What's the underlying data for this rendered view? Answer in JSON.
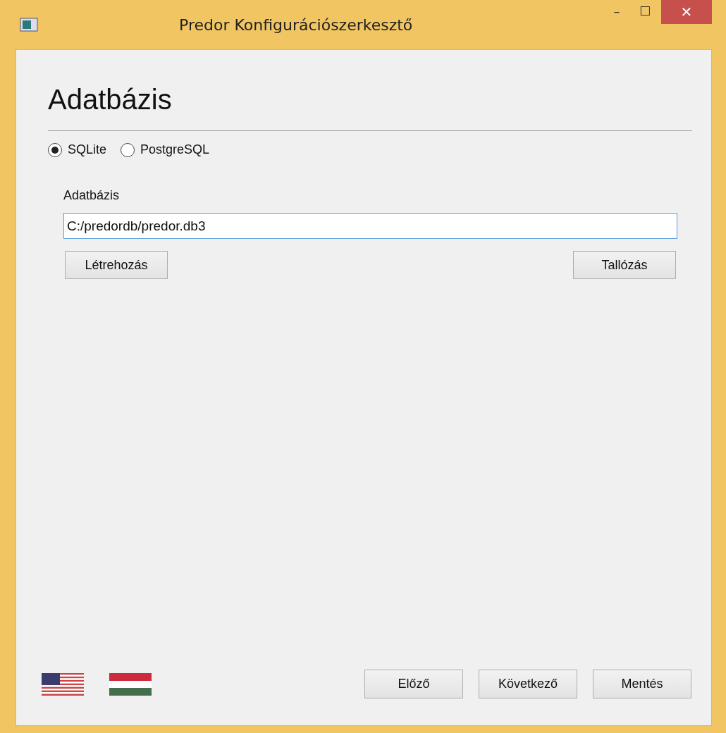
{
  "window": {
    "title": "Predor Konfigurációszerkesztő",
    "controls": [
      "–",
      "☐",
      "✕"
    ]
  },
  "heading": "Adatbázis",
  "database_type": [
    {
      "label": "SQLite",
      "selected": true
    },
    {
      "label": "PostgreSQL",
      "selected": false
    }
  ],
  "database_field": {
    "label": "Adatbázis",
    "value": "C:/predordb/predor.db3"
  },
  "field_buttons": [
    "Létrehozás",
    "Tallózás"
  ],
  "languages": [
    {
      "kind": "us"
    },
    {
      "kind": "hu"
    }
  ],
  "nav_buttons": [
    "Előző",
    "Következő",
    "Mentés"
  ]
}
